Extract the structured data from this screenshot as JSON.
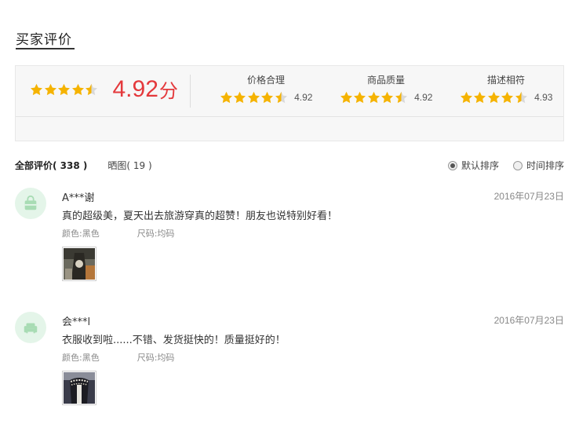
{
  "section": {
    "title": "买家评价"
  },
  "summary": {
    "score": "4.92",
    "unit": "分",
    "overall_rating": 4.92,
    "star_color": "#f5b301",
    "metrics": [
      {
        "label": "价格合理",
        "value": "4.92",
        "rating": 4.92
      },
      {
        "label": "商品质量",
        "value": "4.92",
        "rating": 4.92
      },
      {
        "label": "描述相符",
        "value": "4.93",
        "rating": 4.93
      }
    ]
  },
  "tabs": {
    "all_label": "全部评价",
    "all_count": "( 338 )",
    "img_label": "晒图",
    "img_count": "( 19 )"
  },
  "sort": {
    "default_label": "默认排序",
    "time_label": "时间排序",
    "selected": "default"
  },
  "reviews": [
    {
      "user": "A***谢",
      "date": "2016年07月23日",
      "content": "真的超级美，夏天出去旅游穿真的超赞！朋友也说特别好看！",
      "color": "颜色:黑色",
      "size": "尺码:均码",
      "avatar_icon": "shopping-bag-icon"
    },
    {
      "user": "会***l",
      "date": "2016年07月23日",
      "content": "衣服收到啦......不错、发货挺快的！质量挺好的！",
      "color": "颜色:黑色",
      "size": "尺码:均码",
      "avatar_icon": "sofa-icon"
    }
  ]
}
